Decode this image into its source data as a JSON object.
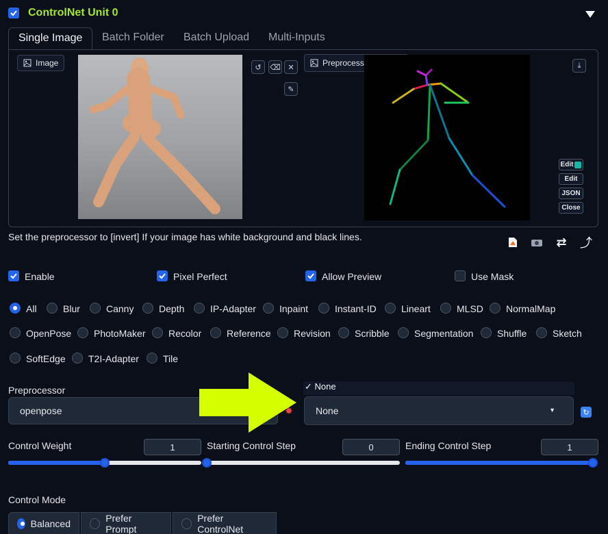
{
  "unit": {
    "title": "ControlNet Unit 0"
  },
  "tabs": [
    "Single Image",
    "Batch Folder",
    "Batch Upload",
    "Multi-Inputs"
  ],
  "image_panel": {
    "image_label": "Image",
    "preview_label": "Preprocessor Preview"
  },
  "side_buttons": [
    "Edit",
    "Edit",
    "JSON",
    "Close"
  ],
  "hint": "Set the preprocessor to [invert] If your image has white background and black lines.",
  "toggles": {
    "enable": "Enable",
    "pixel_perfect": "Pixel Perfect",
    "allow_preview": "Allow Preview",
    "use_mask": "Use Mask"
  },
  "control_types": [
    "All",
    "Blur",
    "Canny",
    "Depth",
    "IP-Adapter",
    "Inpaint",
    "Instant-ID",
    "Lineart",
    "MLSD",
    "NormalMap",
    "OpenPose",
    "PhotoMaker",
    "Recolor",
    "Reference",
    "Revision",
    "Scribble",
    "Segmentation",
    "Shuffle",
    "Sketch",
    "SoftEdge",
    "T2I-Adapter",
    "Tile"
  ],
  "selected_control_type": "All",
  "preprocessor": {
    "label": "Preprocessor",
    "value": "openpose"
  },
  "model": {
    "dropdown_option": "None",
    "value": "None"
  },
  "sliders": {
    "control_weight": {
      "label": "Control Weight",
      "value": "1",
      "fraction": 0.5
    },
    "starting_step": {
      "label": "Starting Control Step",
      "value": "0",
      "fraction": 0.0
    },
    "ending_step": {
      "label": "Ending Control Step",
      "value": "1",
      "fraction": 1.0
    }
  },
  "control_mode": {
    "label": "Control Mode",
    "options": [
      "Balanced",
      "Prefer Prompt",
      "Prefer ControlNet"
    ],
    "selected": "Balanced"
  },
  "colors": {
    "accent": "#2563eb",
    "title_green": "#a3e635",
    "arrow": "#d4ff00",
    "background": "#0b0f19"
  }
}
